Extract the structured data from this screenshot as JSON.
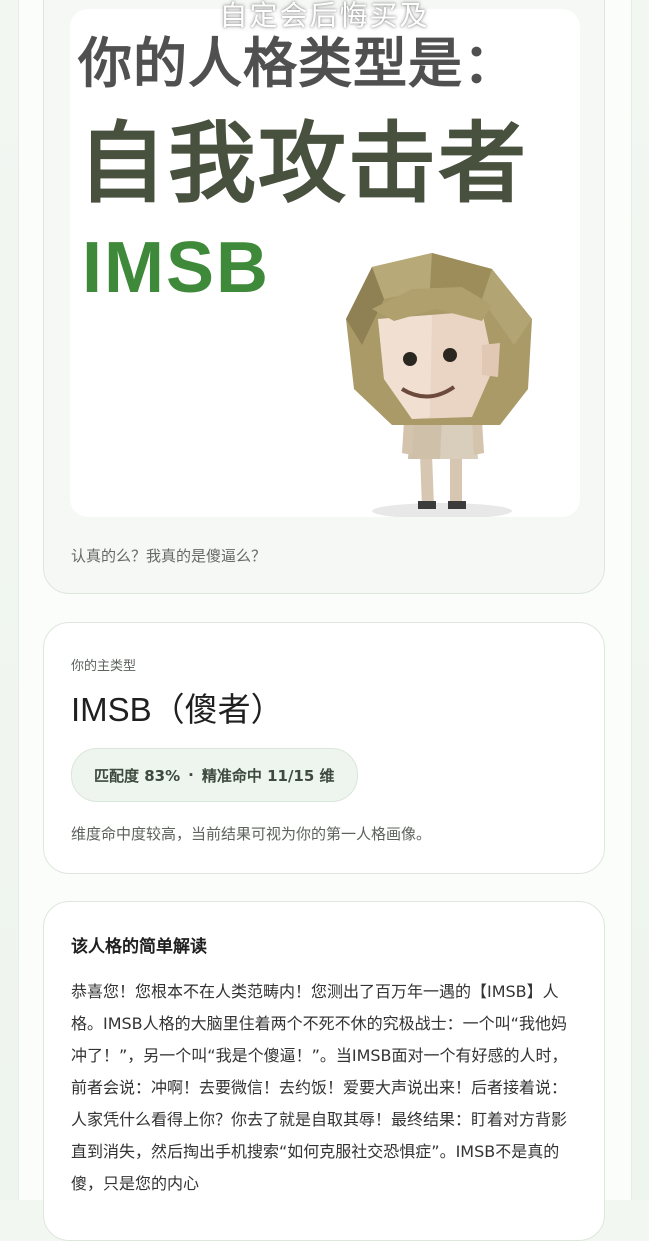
{
  "header_overlay": "自定会后悔买及",
  "result_image": {
    "line1": "你的人格类型是：",
    "line2": "自我攻击者",
    "line3": "IMSB",
    "caption": "认真的么？我真的是傻逼么？"
  },
  "main_type": {
    "label": "你的主类型",
    "value": "IMSB（傻者）",
    "match_label": "匹配度 83%",
    "dot": "·",
    "hits_label": "精准命中 11/15 维",
    "note": "维度命中度较高，当前结果可视为你的第一人格画像。"
  },
  "reading": {
    "title": "该人格的简单解读",
    "body": "恭喜您！您根本不在人类范畴内！您测出了百万年一遇的【IMSB】人格。IMSB人格的大脑里住着两个不死不休的究极战士：一个叫“我他妈冲了！”，另一个叫“我是个傻逼！”。当IMSB面对一个有好感的人时，前者会说：冲啊！去要微信！去约饭！爱要大声说出来！后者接着说：人家凭什么看得上你？你去了就是自取其辱！最终结果：盯着对方背影直到消失，然后掏出手机搜索“如何克服社交恐惧症”。IMSB不是真的傻，只是您的内心"
  },
  "colors": {
    "accent_green": "#3e8a3a",
    "pill_bg": "#eef4ee",
    "card_border": "#dde7dc"
  }
}
